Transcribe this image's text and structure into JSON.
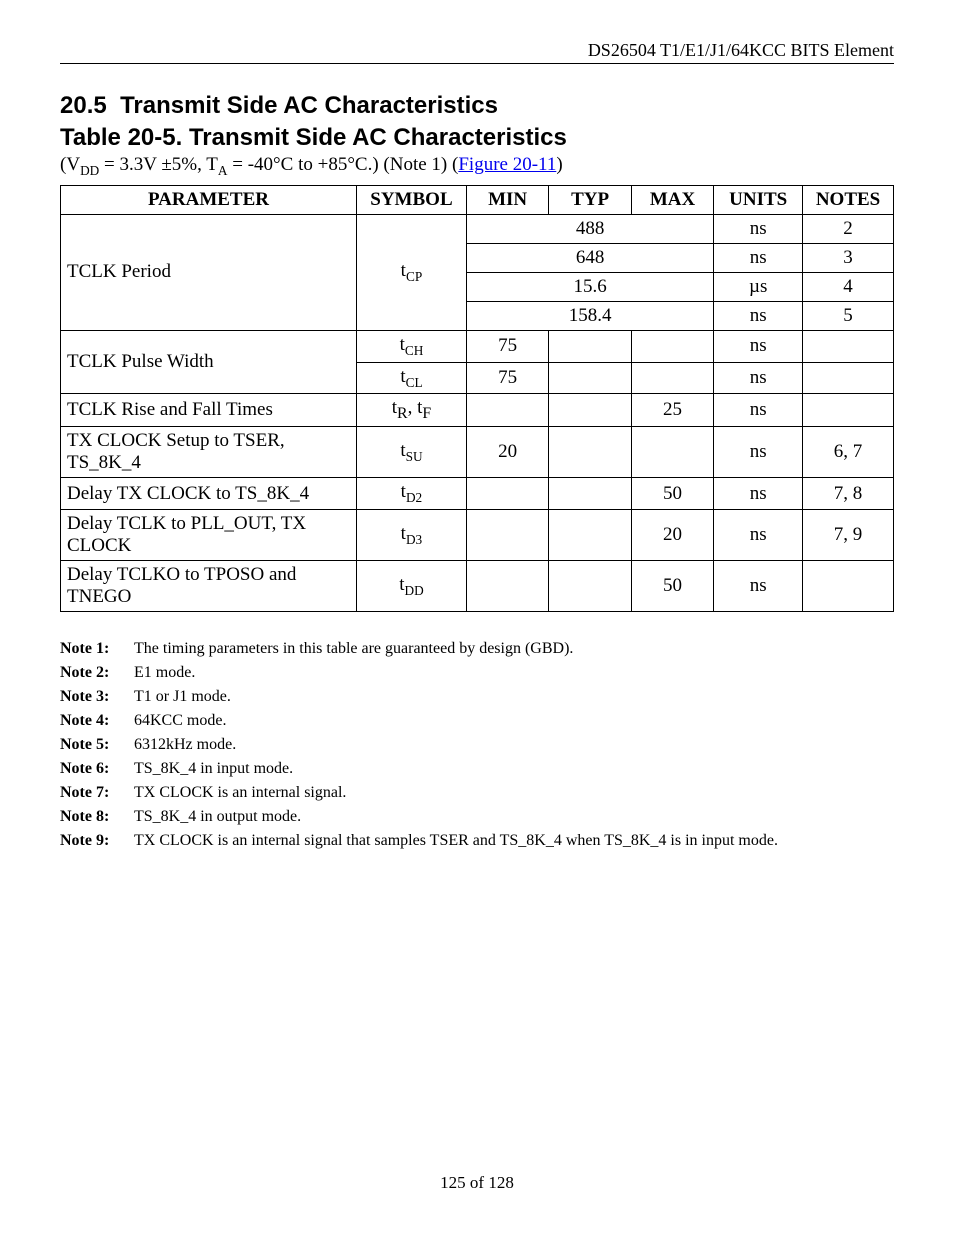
{
  "header": {
    "right": "DS26504 T1/E1/J1/64KCC BITS Element"
  },
  "section": {
    "number": "20.5",
    "title": "Transmit Side AC Characteristics"
  },
  "table_title": "Table 20-5. Transmit Side AC Characteristics",
  "conditions": {
    "prefix": "(V",
    "vdd_sub": "DD",
    "part2": " = 3.3V ±5%, T",
    "ta_sub": "A",
    "part3": " = -40°C to +85°C.) (Note 1) (",
    "link": "Figure 20-11",
    "suffix": ")"
  },
  "columns": {
    "parameter": "PARAMETER",
    "symbol": "SYMBOL",
    "min": "MIN",
    "typ": "TYP",
    "max": "MAX",
    "units": "UNITS",
    "notes": "NOTES"
  },
  "rows": [
    {
      "parameter": "TCLK Period",
      "rowspan": 4,
      "symbol": {
        "base": "t",
        "sub": "CP"
      },
      "symspan": 4,
      "min": "",
      "typ": "488",
      "max": "",
      "typcolspan": 3,
      "units": "ns",
      "notes": "2"
    },
    {
      "min": "",
      "typ": "648",
      "max": "",
      "typcolspan": 3,
      "units": "ns",
      "notes": "3"
    },
    {
      "min": "",
      "typ": "15.6",
      "max": "",
      "typcolspan": 3,
      "units": "µs",
      "notes": "4"
    },
    {
      "min": "",
      "typ": "158.4",
      "max": "",
      "typcolspan": 3,
      "units": "ns",
      "notes": "5"
    },
    {
      "parameter": "TCLK Pulse Width",
      "rowspan": 2,
      "symbol": {
        "base": "t",
        "sub": "CH"
      },
      "min": "75",
      "typ": "",
      "max": "",
      "units": "ns",
      "notes": ""
    },
    {
      "symbol": {
        "base": "t",
        "sub": "CL"
      },
      "min": "75",
      "typ": "",
      "max": "",
      "units": "ns",
      "notes": ""
    },
    {
      "parameter": "TCLK Rise and Fall Times",
      "symbol_text": "t<sub>R</sub>, t<sub>F</sub>",
      "min": "",
      "typ": "",
      "max": "25",
      "units": "ns",
      "notes": ""
    },
    {
      "parameter": "TX CLOCK Setup to TSER, TS_8K_4",
      "symbol": {
        "base": "t",
        "sub": "SU"
      },
      "min": "20",
      "typ": "",
      "max": "",
      "units": "ns",
      "notes": "6, 7"
    },
    {
      "parameter": "Delay TX CLOCK to TS_8K_4",
      "symbol": {
        "base": "t",
        "sub": "D2"
      },
      "min": "",
      "typ": "",
      "max": "50",
      "units": "ns",
      "notes": "7, 8"
    },
    {
      "parameter": "Delay TCLK to PLL_OUT, TX CLOCK",
      "symbol": {
        "base": "t",
        "sub": "D3"
      },
      "min": "",
      "typ": "",
      "max": "20",
      "units": "ns",
      "notes": "7, 9"
    },
    {
      "parameter": "Delay TCLKO to TPOSO and TNEGO",
      "symbol": {
        "base": "t",
        "sub": "DD"
      },
      "min": "",
      "typ": "",
      "max": "50",
      "units": "ns",
      "notes": ""
    }
  ],
  "footnotes": [
    {
      "label": "Note 1:",
      "text": "The timing parameters in this table are guaranteed by design (GBD)."
    },
    {
      "label": "Note 2:",
      "text": "E1 mode."
    },
    {
      "label": "Note 3:",
      "text": "T1 or J1 mode."
    },
    {
      "label": "Note 4:",
      "text": "64KCC mode."
    },
    {
      "label": "Note 5:",
      "text": "6312kHz mode."
    },
    {
      "label": "Note 6:",
      "text": "TS_8K_4 in input mode."
    },
    {
      "label": "Note 7:",
      "text": "TX CLOCK is an internal signal."
    },
    {
      "label": "Note 8:",
      "text": "TS_8K_4 in output mode."
    },
    {
      "label": "Note 9:",
      "text": "TX CLOCK is an internal signal that samples TSER and TS_8K_4 when TS_8K_4 is in input mode."
    }
  ],
  "footer": "125 of 128"
}
